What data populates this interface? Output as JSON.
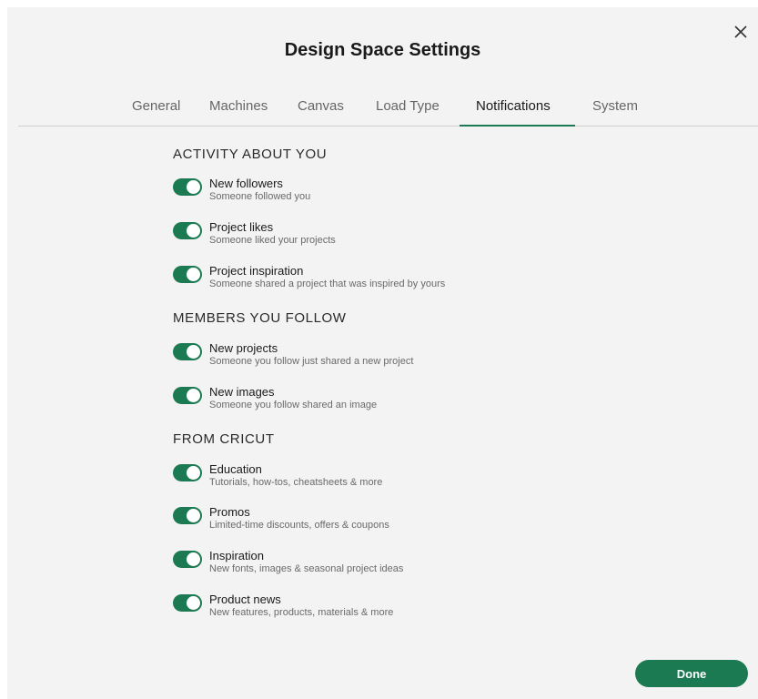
{
  "dialog": {
    "title": "Design Space Settings",
    "close_icon": "close-icon"
  },
  "tabs": [
    {
      "label": "General",
      "active": false
    },
    {
      "label": "Machines",
      "active": false
    },
    {
      "label": "Canvas",
      "active": false
    },
    {
      "label": "Load Type",
      "active": false
    },
    {
      "label": "Notifications",
      "active": true
    },
    {
      "label": "System",
      "active": false
    }
  ],
  "sections": [
    {
      "title": "ACTIVITY ABOUT YOU",
      "items": [
        {
          "label": "New followers",
          "description": "Someone followed you",
          "enabled": true
        },
        {
          "label": "Project likes",
          "description": "Someone liked your projects",
          "enabled": true
        },
        {
          "label": "Project inspiration",
          "description": "Someone shared a project that was inspired by yours",
          "enabled": true
        }
      ]
    },
    {
      "title": "MEMBERS YOU FOLLOW",
      "items": [
        {
          "label": "New projects",
          "description": "Someone you follow just shared a new project",
          "enabled": true
        },
        {
          "label": "New images",
          "description": "Someone you follow shared an image",
          "enabled": true
        }
      ]
    },
    {
      "title": "FROM CRICUT",
      "items": [
        {
          "label": "Education",
          "description": "Tutorials, how-tos, cheatsheets & more",
          "enabled": true
        },
        {
          "label": "Promos",
          "description": "Limited-time discounts, offers & coupons",
          "enabled": true
        },
        {
          "label": "Inspiration",
          "description": "New fonts, images & seasonal project ideas",
          "enabled": true
        },
        {
          "label": "Product news",
          "description": "New features, products, materials & more",
          "enabled": true
        }
      ]
    }
  ],
  "footer": {
    "done_label": "Done"
  },
  "colors": {
    "accent": "#1c7a52",
    "background": "#f3f3f3"
  }
}
